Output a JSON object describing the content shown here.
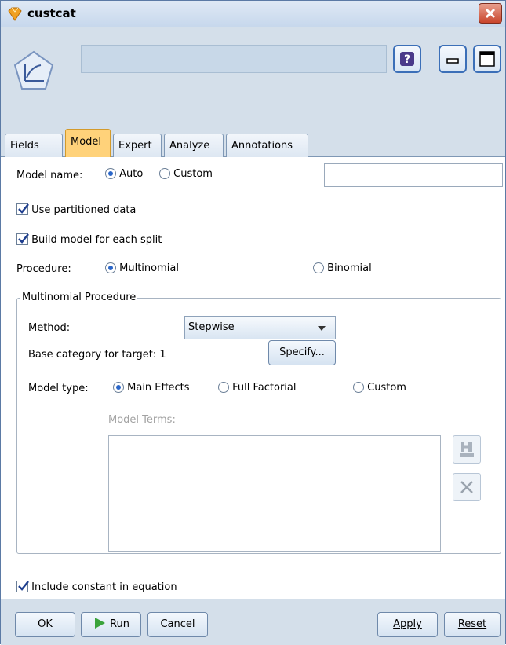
{
  "window": {
    "title": "custcat"
  },
  "tabs": [
    {
      "label": "Fields"
    },
    {
      "label": "Model"
    },
    {
      "label": "Expert"
    },
    {
      "label": "Analyze"
    },
    {
      "label": "Annotations"
    }
  ],
  "model": {
    "name_label": "Model name:",
    "auto_label": "Auto",
    "custom_label": "Custom",
    "name_value": "",
    "use_partitioned_label": "Use partitioned data",
    "build_split_label": "Build model for each split",
    "procedure_label": "Procedure:",
    "multinomial_label": "Multinomial",
    "binomial_label": "Binomial"
  },
  "multinomial": {
    "group_title": "Multinomial Procedure",
    "method_label": "Method:",
    "method_value": "Stepwise",
    "base_category_label": "Base category for target: 1",
    "specify_label": "Specify...",
    "model_type_label": "Model type:",
    "main_effects_label": "Main Effects",
    "full_factorial_label": "Full Factorial",
    "custom_label": "Custom",
    "model_terms_label": "Model Terms:"
  },
  "include_constant_label": "Include constant in equation",
  "buttons": {
    "ok": "OK",
    "run": "Run",
    "cancel": "Cancel",
    "apply": "Apply",
    "reset": "Reset"
  },
  "colors": {
    "active_tab": "#ffd27a",
    "header_bg": "#d4dfea"
  },
  "icons": [
    "app-icon",
    "node-icon",
    "help-icon",
    "minimize-icon",
    "maximize-icon",
    "close-icon",
    "run-icon",
    "add-terms-icon",
    "delete-icon"
  ]
}
